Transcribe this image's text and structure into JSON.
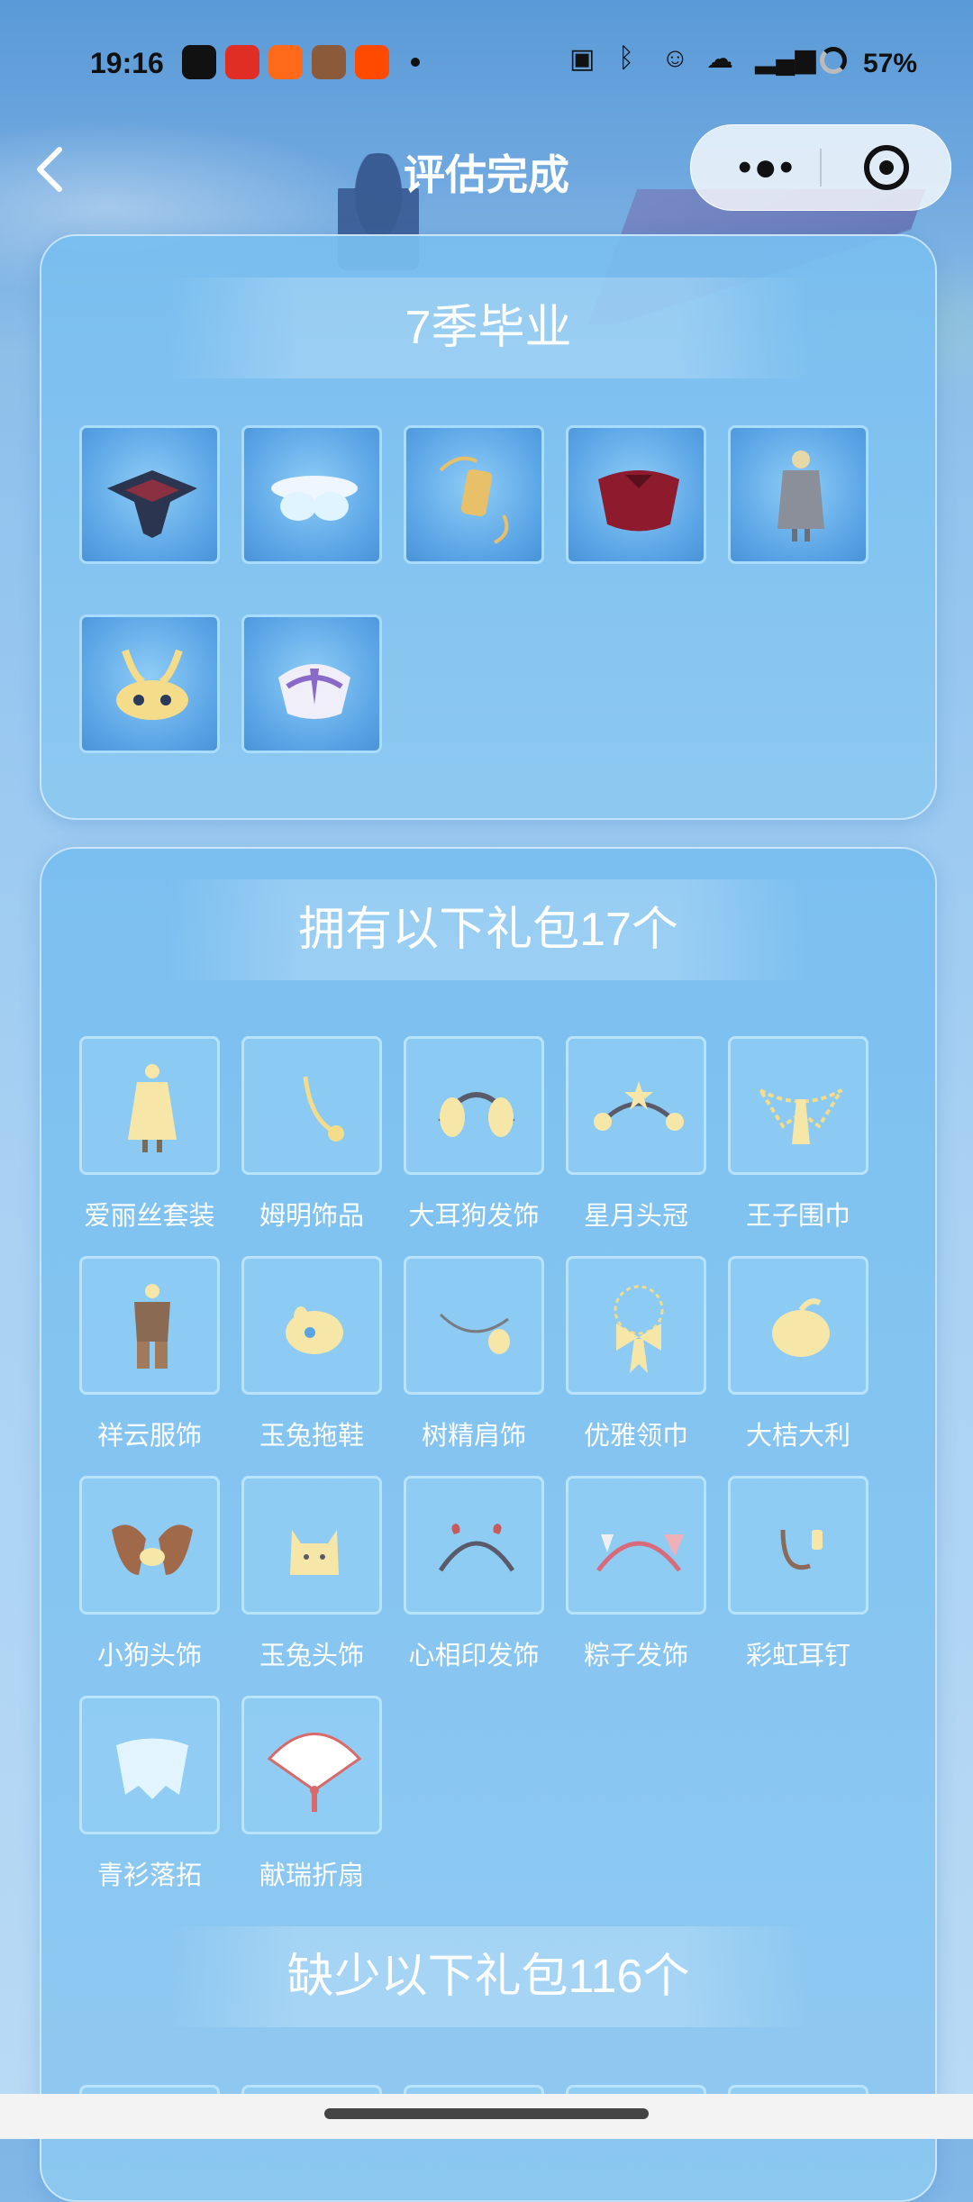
{
  "status_bar": {
    "time": "19:16",
    "battery": "57%",
    "apps": [
      {
        "name": "dewu-app-icon",
        "color": "#111111"
      },
      {
        "name": "pinduoduo-icon",
        "color": "#e02e24"
      },
      {
        "name": "shop-app-icon",
        "color": "#ff6a1a"
      },
      {
        "name": "game-avatar-icon",
        "color": "#8a5a3a"
      },
      {
        "name": "taobao-icon",
        "color": "#ff4a00"
      }
    ]
  },
  "nav": {
    "title": "评估完成",
    "back_icon": "chevron-left-icon",
    "more_icon": "more-dots-icon",
    "close_icon": "target-circle-icon"
  },
  "graduation": {
    "title": "7季毕业",
    "items": [
      {
        "icon": "dark-cape-icon"
      },
      {
        "icon": "white-wing-icon"
      },
      {
        "icon": "golden-charm-icon"
      },
      {
        "icon": "red-feather-cape-icon"
      },
      {
        "icon": "grey-robe-icon"
      },
      {
        "icon": "golden-mask-icon"
      },
      {
        "icon": "purple-skirt-icon"
      }
    ]
  },
  "owned": {
    "title": "拥有以下礼包17个",
    "items": [
      {
        "label": "爱丽丝套装",
        "icon": "dress-icon"
      },
      {
        "label": "姆明饰品",
        "icon": "tail-icon"
      },
      {
        "label": "大耳狗发饰",
        "icon": "headband-ears-icon"
      },
      {
        "label": "星月头冠",
        "icon": "star-moon-crown-icon"
      },
      {
        "label": "王子围巾",
        "icon": "scarf-icon"
      },
      {
        "label": "祥云服饰",
        "icon": "outfit-icon"
      },
      {
        "label": "玉兔拖鞋",
        "icon": "slipper-icon"
      },
      {
        "label": "树精肩饰",
        "icon": "shoulder-pet-icon"
      },
      {
        "label": "优雅领巾",
        "icon": "bow-necklace-icon"
      },
      {
        "label": "大桔大利",
        "icon": "orange-icon"
      },
      {
        "label": "小狗头饰",
        "icon": "puppy-ears-icon"
      },
      {
        "label": "玉兔头饰",
        "icon": "bunny-head-icon"
      },
      {
        "label": "心相印发饰",
        "icon": "heart-headband-icon"
      },
      {
        "label": "粽子发饰",
        "icon": "zongzi-headband-icon"
      },
      {
        "label": "彩虹耳钉",
        "icon": "earring-icon"
      },
      {
        "label": "青衫落拓",
        "icon": "blue-cape-icon"
      },
      {
        "label": "献瑞折扇",
        "icon": "folding-fan-icon"
      }
    ]
  },
  "missing": {
    "title": "缺少以下礼包116个"
  }
}
